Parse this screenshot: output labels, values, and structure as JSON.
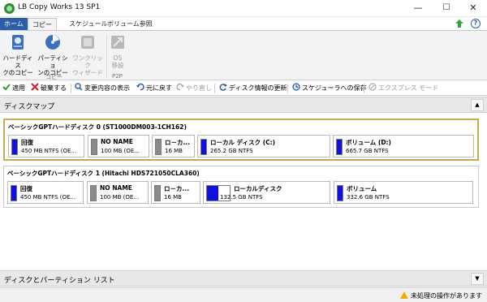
{
  "window": {
    "title": "LB Copy Works 13 SP1",
    "minimize": "—",
    "maximize": "☐",
    "close": "✕"
  },
  "tabs": [
    {
      "label": "ホーム"
    },
    {
      "label": "コピー"
    },
    {
      "label": "スケジュール"
    },
    {
      "label": "ボリューム参照"
    }
  ],
  "help": "?",
  "ribbon": {
    "buttons": [
      {
        "line1": "ハードディス",
        "line2": "クのコピー"
      },
      {
        "line1": "パーティショ",
        "line2": "ンのコピー"
      },
      {
        "line1": "ワンクリック",
        "line2": "ウィザード"
      },
      {
        "line1": "OS",
        "line2": "移設"
      }
    ],
    "groups": {
      "copy": "コピー",
      "p2p": "P2P"
    }
  },
  "toolbar": {
    "apply": "適用",
    "discard": "破棄する",
    "show_changes": "変更内容の表示",
    "undo": "元に戻す",
    "redo": "やり直し",
    "refresh": "ディスク情報の更新",
    "save_schedule": "スケジューラへの保存",
    "express_mode": "エクスプレス モード"
  },
  "sections": {
    "diskmap": "ディスクマップ",
    "partition_list": "ディスクとパーティション リスト",
    "collapse_up": "▲",
    "collapse_down": "▼"
  },
  "disks": [
    {
      "title": "ベーシックGPTハードディスク 0 (ST1000DM003-1CH162)",
      "partitions": [
        {
          "name": "回復",
          "info": "450 MB NTFS (OE...",
          "bar": "blue"
        },
        {
          "name": "NO NAME",
          "info": "100 MB (OE...",
          "bar": "gray"
        },
        {
          "name": "ロ－カ...",
          "info": "16 MB",
          "bar": "gray"
        },
        {
          "name": "ローカル ディスク (C:)",
          "info": "265.2 GB NTFS",
          "bar": "blue"
        },
        {
          "name": "ボリューム (D:)",
          "info": "665.7 GB NTFS",
          "bar": "blue"
        }
      ]
    },
    {
      "title": "ベーシックGPTハードディスク 1 (Hitachi HDS721050CLA360)",
      "partitions": [
        {
          "name": "回復",
          "info": "450 MB NTFS (OE...",
          "bar": "blue"
        },
        {
          "name": "NO NAME",
          "info": "100 MB (OE...",
          "bar": "gray"
        },
        {
          "name": "ロ－カ...",
          "info": "16 MB",
          "bar": "gray"
        },
        {
          "name": "ローカルディスク",
          "info": "132.5 GB NTFS",
          "bar": "mixed"
        },
        {
          "name": "ボリューム",
          "info": "332.6 GB NTFS",
          "bar": "blue"
        }
      ]
    }
  ],
  "status": {
    "pending": "未処理の操作があります"
  }
}
